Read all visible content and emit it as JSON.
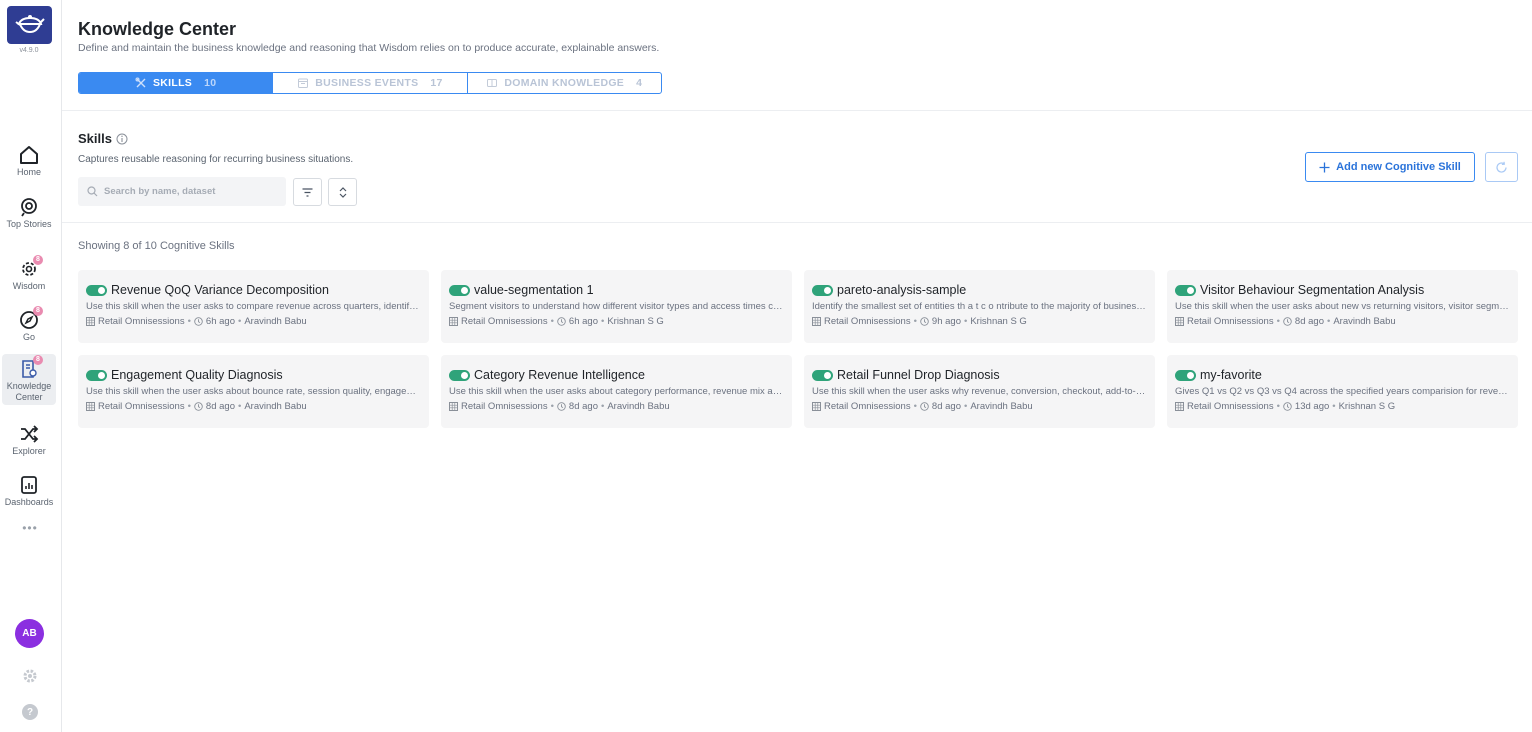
{
  "app": {
    "version": "v4.9.0"
  },
  "nav": {
    "items": [
      {
        "label": "Home",
        "icon": "home-icon"
      },
      {
        "label": "Top Stories",
        "icon": "stories-icon"
      },
      {
        "label": "Wisdom",
        "icon": "wisdom-icon",
        "badge": "8"
      },
      {
        "label": "Go",
        "icon": "compass-icon",
        "badge": "8"
      },
      {
        "label": "Knowledge Center",
        "icon": "knowledge-icon",
        "badge": "8"
      },
      {
        "label": "Explorer",
        "icon": "shuffle-icon"
      },
      {
        "label": "Dashboards",
        "icon": "dashboard-icon"
      }
    ],
    "more": "•••",
    "avatar": "AB",
    "help": "?"
  },
  "header": {
    "title": "Knowledge Center",
    "subtitle": "Define and maintain the business knowledge and reasoning that Wisdom relies on to produce accurate, explainable answers."
  },
  "tabs": [
    {
      "label": "SKILLS",
      "count": "10",
      "active": true
    },
    {
      "label": "BUSINESS EVENTS",
      "count": "17",
      "active": false
    },
    {
      "label": "DOMAIN KNOWLEDGE",
      "count": "4",
      "active": false
    }
  ],
  "skills": {
    "title": "Skills",
    "subtitle": "Captures reusable reasoning for recurring business situations.",
    "search_placeholder": "Search by name, dataset",
    "add_label": "Add new Cognitive Skill",
    "showing": "Showing 8 of 10 Cognitive Skills"
  },
  "cards": [
    {
      "title": "Revenue QoQ Variance Decomposition",
      "desc": "Use this skill when the user asks to compare revenue across quarters, identify what drove the change",
      "dataset": "Retail Omnisessions",
      "time": "6h ago",
      "author": "Aravindh Babu",
      "enabled": true
    },
    {
      "title": "value-segmentation 1",
      "desc": "Segment visitors to understand how different visitor types and access times contribute to value",
      "dataset": "Retail Omnisessions",
      "time": "6h ago",
      "author": "Krishnan S G",
      "enabled": true
    },
    {
      "title": "pareto-analysis-sample",
      "desc": "Identify the smallest set of entities th a t c o ntribute to the majority of business outcomes",
      "dataset": "Retail Omnisessions",
      "time": "9h ago",
      "author": "Krishnan S G",
      "enabled": true
    },
    {
      "title": "Visitor Behaviour Segmentation Analysis",
      "desc": "Use this skill when the user asks about new vs returning visitors, visitor segments and behaviour",
      "dataset": "Retail Omnisessions",
      "time": "8d ago",
      "author": "Aravindh Babu",
      "enabled": true
    },
    {
      "title": "Engagement Quality Diagnosis",
      "desc": "Use this skill when the user asks about bounce rate, session quality, engagement depth and drop-offs",
      "dataset": "Retail Omnisessions",
      "time": "8d ago",
      "author": "Aravindh Babu",
      "enabled": true
    },
    {
      "title": "Category Revenue Intelligence",
      "desc": "Use this skill when the user asks about category performance, revenue mix and category trends",
      "dataset": "Retail Omnisessions",
      "time": "8d ago",
      "author": "Aravindh Babu",
      "enabled": true
    },
    {
      "title": "Retail Funnel Drop Diagnosis",
      "desc": "Use this skill when the user asks why revenue, conversion, checkout, add-to-cart rates dropped",
      "dataset": "Retail Omnisessions",
      "time": "8d ago",
      "author": "Aravindh Babu",
      "enabled": true
    },
    {
      "title": "my-favorite",
      "desc": "Gives Q1 vs Q2 vs Q3 vs Q4 across the specified years comparision for revenue and key metrics",
      "dataset": "Retail Omnisessions",
      "time": "13d ago",
      "author": "Krishnan S G",
      "enabled": true
    }
  ],
  "colors": {
    "accent": "#3a8af1",
    "brand": "#2f3d93",
    "toggle_on": "#2fa37a",
    "avatar": "#8b2fe0"
  }
}
